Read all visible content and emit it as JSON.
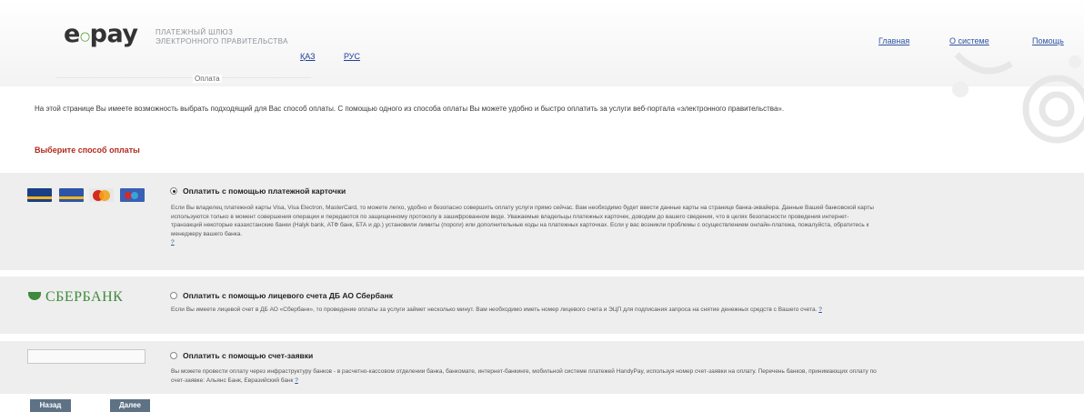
{
  "header": {
    "logo_main": "e",
    "logo_circle": "○",
    "logo_rest": "pay",
    "tagline_line1": "ПЛАТЕЖНЫЙ ШЛЮЗ",
    "tagline_line2": "ЭЛЕКТРОННОГО ПРАВИТЕЛЬСТВА",
    "languages": [
      "ҚАЗ",
      "РУС"
    ],
    "nav": [
      "Главная",
      "О системе",
      "Помощь"
    ],
    "tab": "Оплата"
  },
  "intro_text": "На этой странице Вы имеете возможность выбрать подходящий для Вас способ оплаты. С помощью одного из способа оплаты Вы можете удобно и быстро оплатить за услуги веб-портала «электронного правительства».",
  "choose_label": "Выберите способ оплаты",
  "payment_options": [
    {
      "title": "Оплатить с помощью платежной карточки",
      "selected": true,
      "description": "Если Вы владелец платежной карты Visa, Visa Electron, MasterCard, то можете легко, удобно и безопасно совершить оплату услуги прямо сейчас. Вам необходимо будет ввести данные карты на странице банка-эквайера. Данные Вашей банковской карты используются только в момент совершения операции и передаются по защищенному протоколу в зашифрованном виде. Уважаемые владельцы платежных карточек, доводим до вашего сведения, что в целях безопасности проведения интернет-транзакций некоторые казахстанские банки (Halyk bank, АТФ банк, БТА и др.) установили лимиты (пороги) или дополнительные коды на платежных карточках. Если у вас возникли проблемы с осуществлением онлайн-платежа, пожалуйста, обратитесь к менеджеру вашего банка.",
      "help_link": "?"
    },
    {
      "logo": "СБЕРБАНК",
      "title": "Оплатить с помощью лицевого счета ДБ АО Сбербанк",
      "selected": false,
      "description": "Если Вы имеете лицевой счет в ДБ АО «Сбербанк», то проведение оплаты за услуги займет несколько минут. Вам необходимо иметь номер лицевого счета и ЭЦП для подписания запроса на снятие денежных средств с Вашего счета.",
      "help_link": "?"
    },
    {
      "title": "Оплатить с помощью счет-заявки",
      "selected": false,
      "description": "Вы можете провести оплату через инфраструктуру банков - в расчетно-кассовом отделении банка, банкомате, интернет-банкинге, мобильной системе платежей HandyPay, используя номер счет-заявки на оплату. Перечень банков, принимающих оплату по счет-заявке: Альянс Банк, Евразийский банк",
      "help_link": "?"
    }
  ],
  "cards": [
    "VISA",
    "VISA Electron",
    "MasterCard",
    "Maestro"
  ],
  "buttons": {
    "back": "Назад",
    "next": "Далее"
  },
  "colors": {
    "accent_red": "#b22a1e",
    "link_blue": "#2f54a3",
    "sber_green": "#3f8a3a",
    "button": "#5d7285",
    "section_bg": "#eeeeee"
  }
}
